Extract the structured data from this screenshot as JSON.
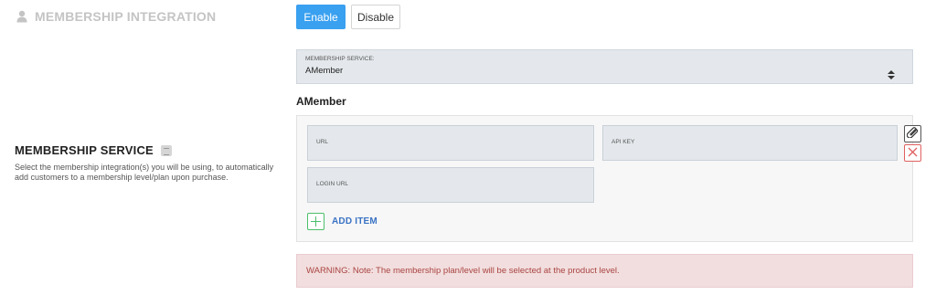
{
  "section": {
    "title": "MEMBERSHIP INTEGRATION",
    "icon": "user-icon"
  },
  "toggle": {
    "enable_label": "Enable",
    "disable_label": "Disable",
    "active": "enable",
    "active_color": "#3aa0f0"
  },
  "membership_service": {
    "heading": "MEMBERSHIP SERVICE",
    "description": "Select the membership integration(s) you will be using, to automatically add customers to a membership level/plan upon purchase.",
    "select": {
      "label": "MEMBERSHIP SERVICE:",
      "value": "AMember"
    }
  },
  "amember": {
    "heading": "AMember",
    "fields": {
      "url_label": "URL",
      "api_key_label": "API KEY",
      "login_url_label": "LOGIN URL"
    },
    "add_item_label": "ADD ITEM",
    "add_item_color": "#4cbf6a",
    "remove_color": "#e06060"
  },
  "warning": {
    "text": "WARNING: Note: The membership plan/level will be selected at the product level.",
    "color": "#a94442"
  }
}
